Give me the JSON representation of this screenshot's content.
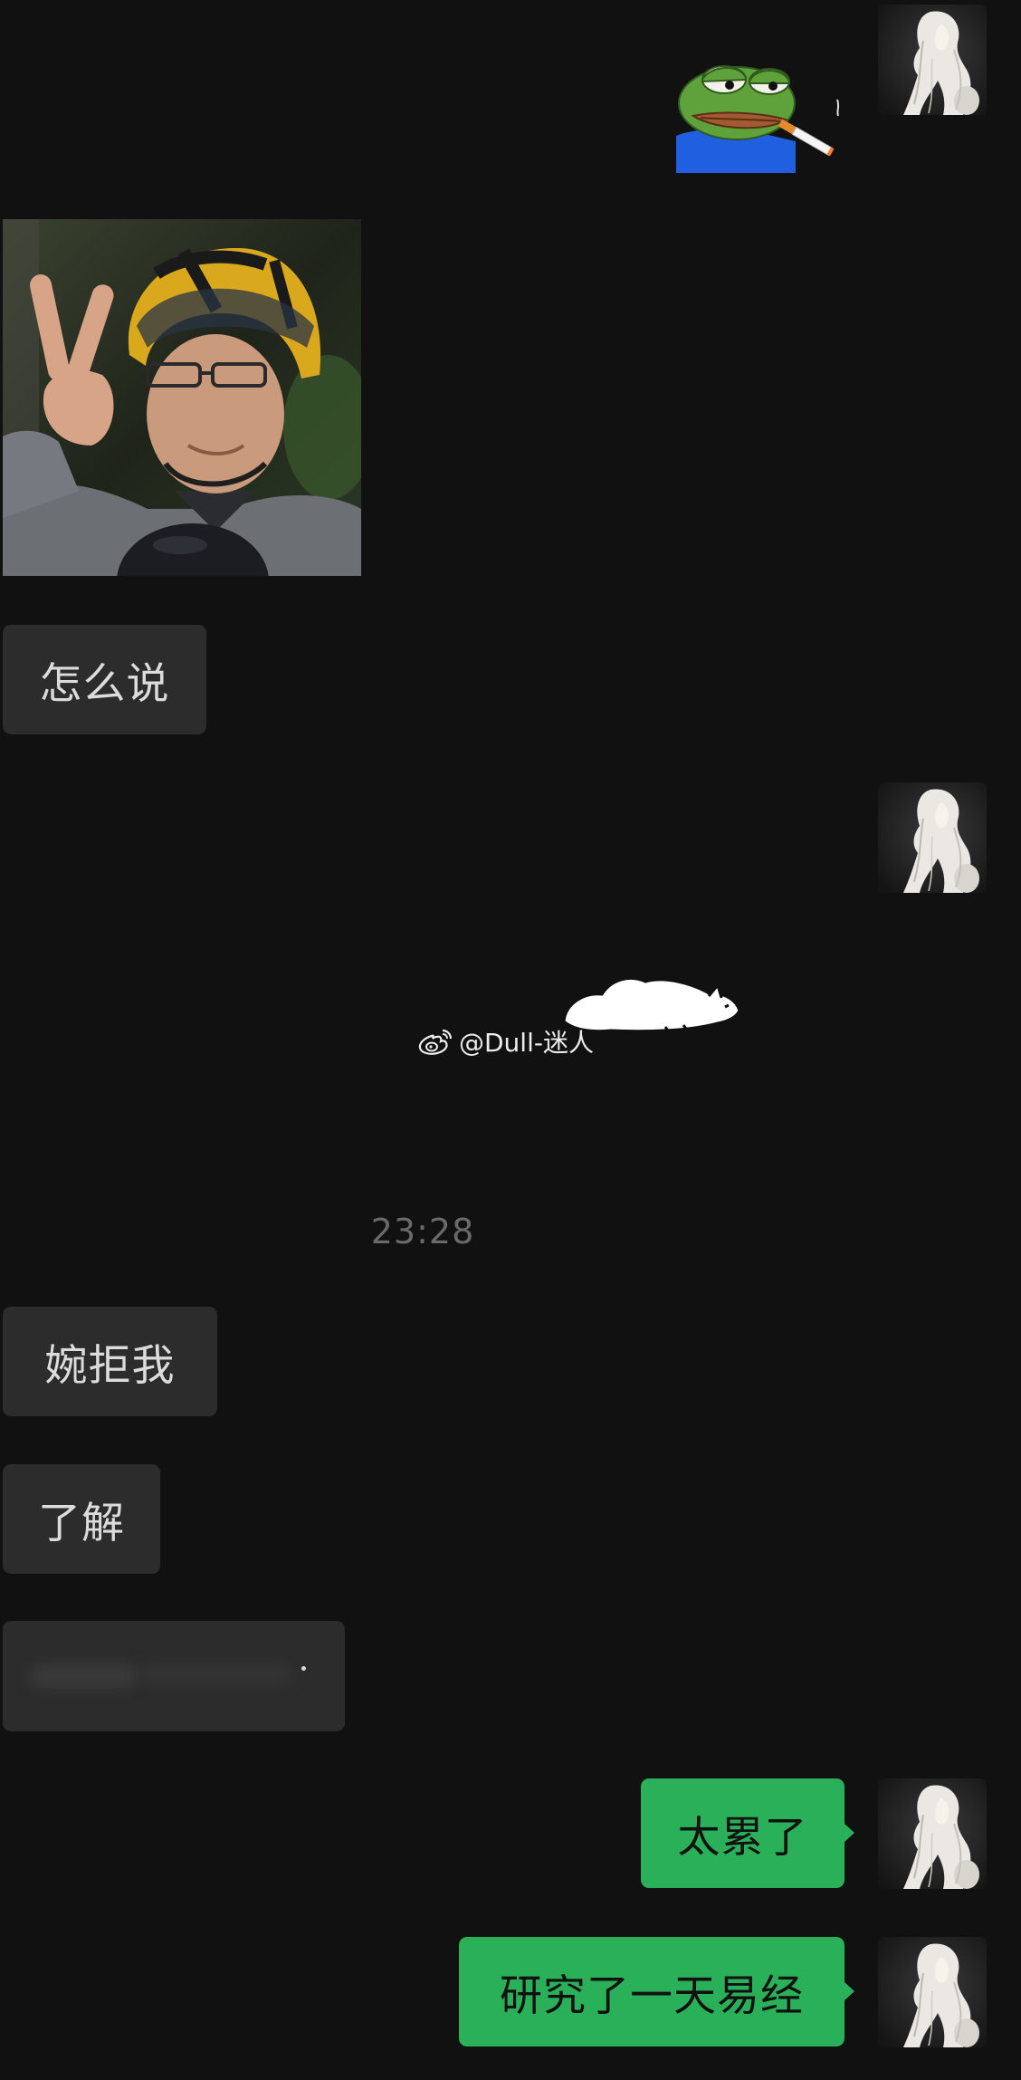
{
  "chat": {
    "messages": [
      {
        "side": "right",
        "kind": "sticker"
      },
      {
        "side": "left",
        "kind": "image"
      },
      {
        "side": "left",
        "kind": "text",
        "text": "怎么说"
      },
      {
        "side": "right",
        "kind": "sticker"
      },
      {
        "side": "left",
        "kind": "text",
        "text": "婉拒我"
      },
      {
        "side": "left",
        "kind": "text",
        "text": "了解"
      },
      {
        "side": "left",
        "kind": "text",
        "blurred": true
      },
      {
        "side": "right",
        "kind": "text",
        "text": "太累了"
      },
      {
        "side": "right",
        "kind": "text",
        "text": "研究了一天易经"
      }
    ],
    "timestamp": "23:28"
  },
  "watermark": {
    "icon": "weibo-icon",
    "text": "@Dull-迷人"
  },
  "colors": {
    "background": "#111111",
    "incoming_bubble": "#2c2c2c",
    "outgoing_bubble": "#2bb05a",
    "incoming_text": "#dcdcdc",
    "outgoing_text": "#111111",
    "timestamp": "#6a6a6a"
  }
}
